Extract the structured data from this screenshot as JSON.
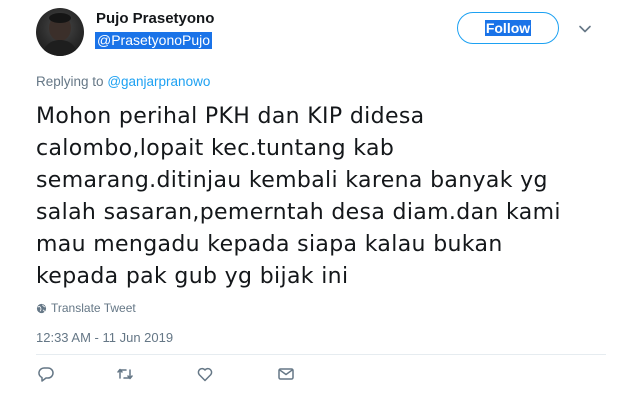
{
  "user": {
    "display_name": "Pujo Prasetyono",
    "screen_name": "@PrasetyonoPujo"
  },
  "follow_label": "Follow",
  "reply_context": {
    "prefix": "Replying to",
    "handle": "@ganjarpranowo"
  },
  "tweet": {
    "text": "Mohon perihal PKH dan KIP didesa\ncalombo,lopait kec.tuntang kab\nsemarang.ditinjau kembali karena banyak yg\nsalah sasaran,pemerntah desa diam.dan kami\nmau mengadu kepada siapa kalau bukan\nkepada pak gub yg bijak ini",
    "translate_label": "Translate Tweet",
    "timestamp": "12:33 AM - 11 Jun 2019"
  },
  "icons": [
    "caret-down-icon",
    "globe-icon",
    "reply-icon",
    "retweet-icon",
    "like-icon",
    "direct-message-icon"
  ],
  "colors": {
    "accent": "#1da1f2",
    "secondary_text": "#657786",
    "selection": "#1a73e8"
  }
}
